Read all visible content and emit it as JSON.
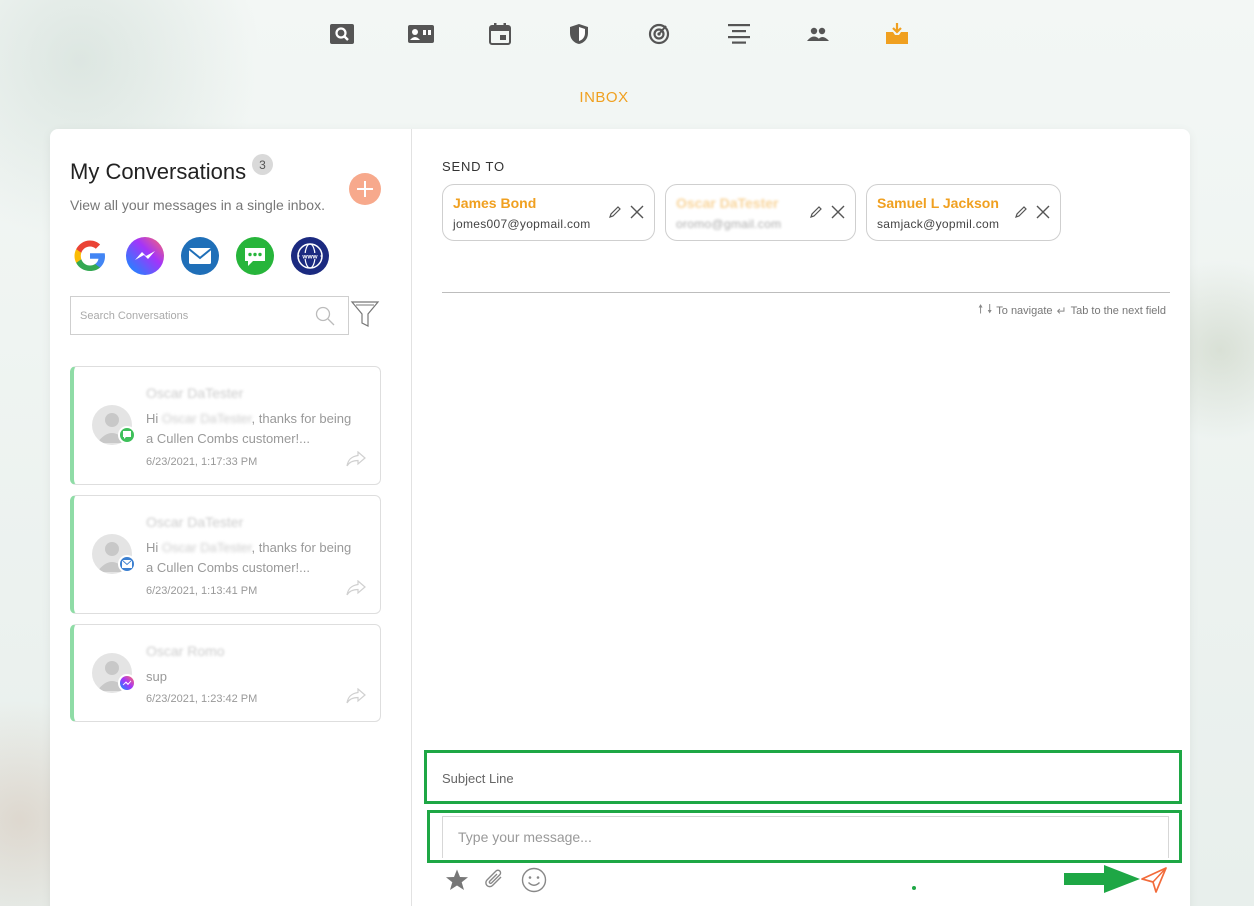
{
  "nav": {
    "items": [
      {
        "icon": "search-icon",
        "color": "#555555"
      },
      {
        "icon": "contact-card-icon",
        "color": "#555555"
      },
      {
        "icon": "calendar-icon",
        "color": "#555555"
      },
      {
        "icon": "shield-icon",
        "color": "#555555"
      },
      {
        "icon": "radar-icon",
        "color": "#555555"
      },
      {
        "icon": "align-center-icon",
        "color": "#555555"
      },
      {
        "icon": "people-icon",
        "color": "#555555"
      },
      {
        "icon": "inbox-icon",
        "color": "#f0a020",
        "active": true
      }
    ],
    "title": "INBOX"
  },
  "conversations": {
    "title": "My Conversations",
    "count": "3",
    "subtitle": "View all your messages in a single inbox.",
    "channels": [
      "google-icon",
      "messenger-icon",
      "email-icon",
      "sms-icon",
      "web-icon"
    ],
    "search_placeholder": "Search Conversations",
    "items": [
      {
        "name": "Oscar DaTester",
        "msg_pre": "Hi",
        "msg_name": "Oscar DaTester",
        "msg_post": ", thanks for being a Cullen Combs customer!...",
        "time": "6/23/2021, 1:17:33 PM",
        "channel": "sms-badge-icon"
      },
      {
        "name": "Oscar DaTester",
        "msg_pre": "Hi",
        "msg_name": "Oscar DaTester",
        "msg_post": ", thanks for being a Cullen Combs customer!...",
        "time": "6/23/2021, 1:13:41 PM",
        "channel": "email-badge-icon"
      },
      {
        "name": "Oscar Romo",
        "msg_pre": "sup",
        "msg_name": "",
        "msg_post": "",
        "time": "6/23/2021, 1:23:42 PM",
        "channel": "messenger-badge-icon"
      }
    ]
  },
  "compose": {
    "send_to_label": "SEND TO",
    "recipients": [
      {
        "name": "James Bond",
        "email": "jomes007@yopmail.com",
        "faded": false
      },
      {
        "name": "Oscar DaTester",
        "email": "oromo@gmail.com",
        "faded": true
      },
      {
        "name": "Samuel L Jackson",
        "email": "samjack@yopmil.com",
        "faded": false
      }
    ],
    "hint_navigate": "To navigate",
    "hint_tab": "Tab to the next field",
    "subject_placeholder": "Subject Line",
    "message_placeholder": "Type your message..."
  },
  "colors": {
    "accent": "#f0a020",
    "highlight": "#1ea745",
    "send": "#f26b3a",
    "conv_border": "#8fdca6"
  }
}
